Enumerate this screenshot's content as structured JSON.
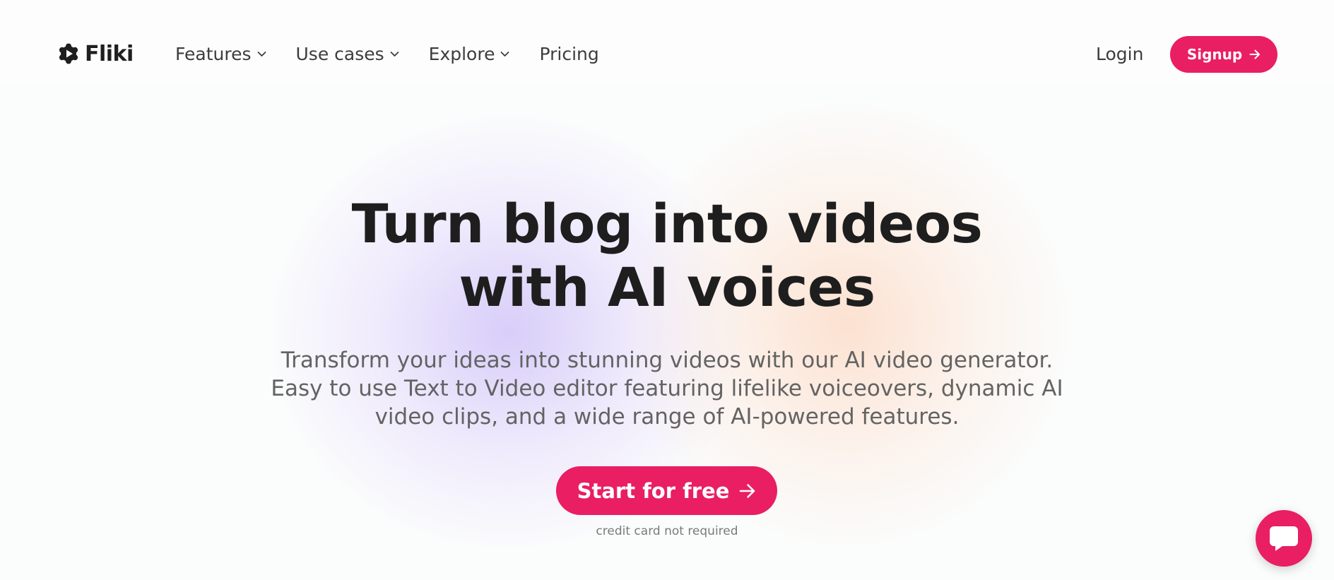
{
  "brand": {
    "name": "Fliki",
    "accent_color": "#e91e63",
    "logo_icon": "play-gear-icon"
  },
  "nav": {
    "items": [
      {
        "label": "Features",
        "has_dropdown": true
      },
      {
        "label": "Use cases",
        "has_dropdown": true
      },
      {
        "label": "Explore",
        "has_dropdown": true
      },
      {
        "label": "Pricing",
        "has_dropdown": false
      }
    ],
    "login_label": "Login",
    "signup_label": "Signup"
  },
  "hero": {
    "title_line1": "Turn blog into videos",
    "title_line2": "with AI voices",
    "subtitle_line1": "Transform your ideas into stunning videos with our AI video generator.",
    "subtitle_line2": "Easy to use Text to Video editor featuring lifelike voiceovers, dynamic AI",
    "subtitle_line3": "video clips, and a wide range of AI-powered features.",
    "cta_label": "Start for free",
    "cta_note": "credit card not required"
  },
  "chat_widget": {
    "icon": "chat-bubble-icon"
  }
}
